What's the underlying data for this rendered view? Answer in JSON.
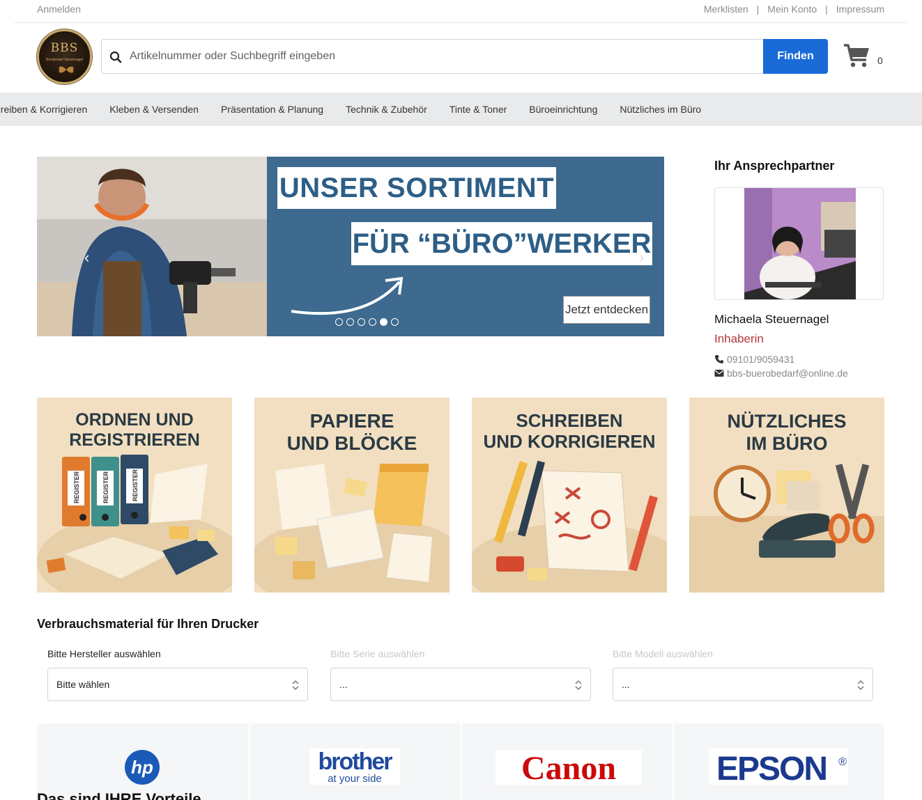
{
  "topbar": {
    "login": "Anmelden",
    "links": [
      "Merklisten",
      "Mein Konto",
      "Impressum"
    ],
    "separator": "|"
  },
  "logo": {
    "text": "BBS",
    "subtext": "Bürobedarf Steuernagel"
  },
  "search": {
    "placeholder": "Artikelnummer oder Suchbegriff eingeben",
    "button": "Finden"
  },
  "cart": {
    "count": "0"
  },
  "nav": {
    "items": [
      "hreiben & Korrigieren",
      "Kleben & Versenden",
      "Präsentation & Planung",
      "Technik & Zubehör",
      "Tinte & Toner",
      "Büroeinrichtung",
      "Nützliches im Büro"
    ]
  },
  "hero": {
    "line1": "UNSER SORTIMENT",
    "line2": "FÜR “BÜRO”WERKER",
    "cta": "Jetzt entdecken",
    "prev": "‹",
    "next": "›",
    "slides": 6,
    "active_slide": 5
  },
  "contact": {
    "heading": "Ihr Ansprechpartner",
    "name": "Michaela Steuernagel",
    "role": "Inhaberin",
    "phone": "09101/9059431",
    "email": "bbs-buerobedarf@online.de"
  },
  "categories": [
    {
      "title": "ORDNEN UND\nREGISTRIEREN",
      "binder_label": "REGISTER"
    },
    {
      "title": "PAPIERE\nUND BLÖCKE"
    },
    {
      "title": "SCHREIBEN\nUND KORRIGIEREN"
    },
    {
      "title": "NÜTZLICHES\nIM BÜRO"
    }
  ],
  "printer": {
    "heading": "Verbrauchsmaterial für Ihren Drucker",
    "manufacturer_label": "Bitte Hersteller auswählen",
    "series_label": "Bitte Serie auswählen",
    "model_label": "Bitte Modell auswählen",
    "manufacturer_value": "Bitte wählen",
    "series_value": "...",
    "model_value": "..."
  },
  "brands": {
    "hp": "hp",
    "brother": "brother",
    "brother_tagline": "at your side",
    "canon": "Canon",
    "epson": "EPSON",
    "epson_mark": "®"
  },
  "advantages_heading": "Das sind IHRE Vorteile",
  "colors": {
    "accent": "#1a6bd8",
    "nav_bg": "#e9eaeb",
    "role_red": "#b4373a",
    "hero_blue": "#3d6a8e",
    "tile_bg": "#f2dfc1"
  }
}
